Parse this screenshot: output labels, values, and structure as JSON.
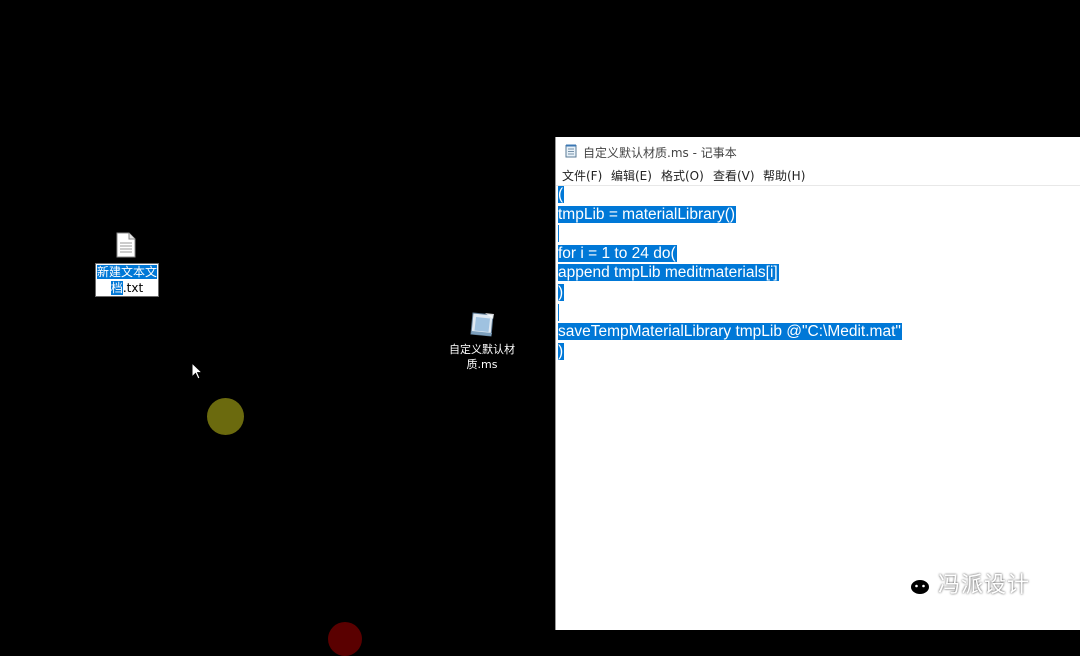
{
  "desktop": {
    "new_file_icon": {
      "label_line1_selected": "新建文本文",
      "label_line2_selected": "档",
      "label_line2_rest": ".txt"
    },
    "ms_file_icon": {
      "label_line1": "自定义默认材",
      "label_line2": "质.ms"
    }
  },
  "notepad": {
    "title": "自定义默认材质.ms - 记事本",
    "menu": [
      "文件(F)",
      "编辑(E)",
      "格式(O)",
      "查看(V)",
      "帮助(H)"
    ],
    "lines": [
      "(",
      "tmpLib = materialLibrary()",
      "",
      "for i = 1 to 24 do(",
      "append tmpLib meditmaterials[i]",
      ")",
      "",
      "saveTempMaterialLibrary tmpLib @\"C:\\Medit.mat\"",
      ")"
    ]
  },
  "watermark": {
    "text": "冯派设计"
  },
  "colors": {
    "selection": "#0078d7",
    "click_indicator": "#6b6a0e"
  }
}
